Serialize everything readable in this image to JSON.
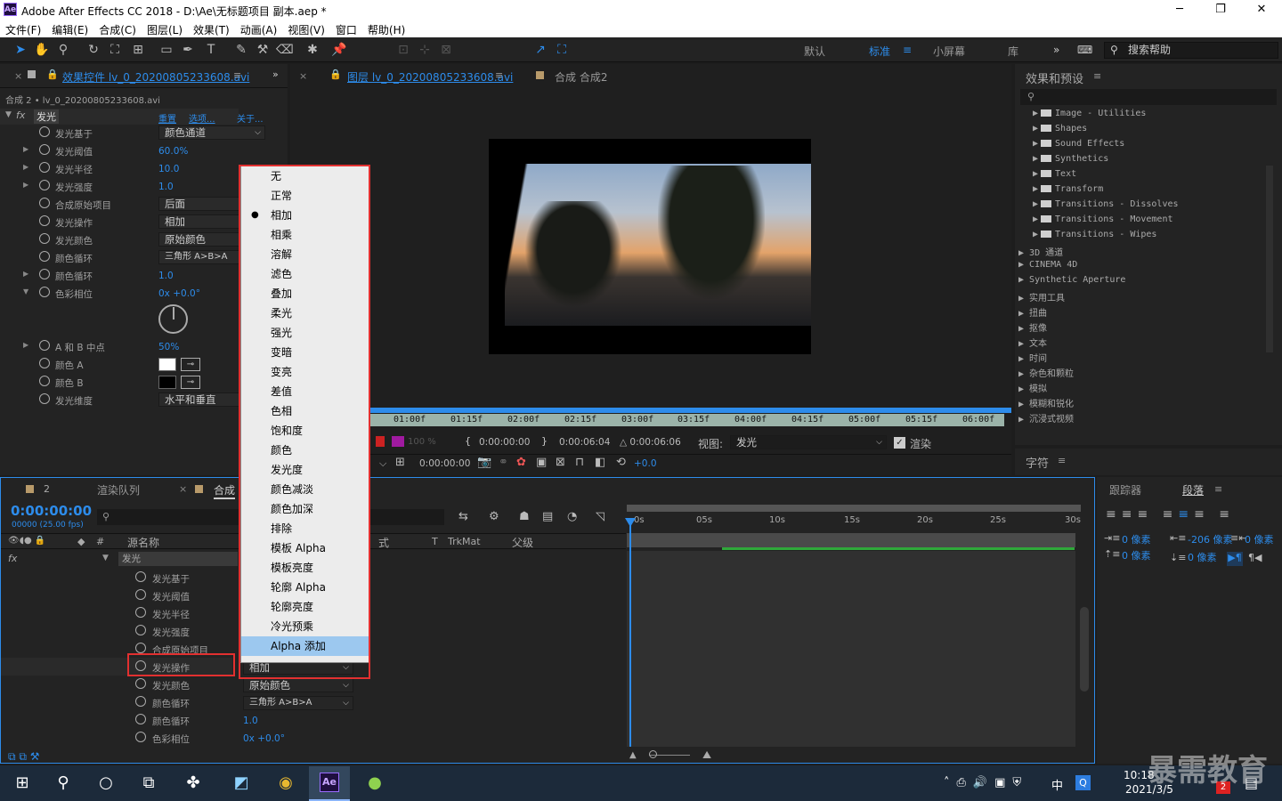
{
  "window": {
    "title": "Adobe After Effects CC 2018 - D:\\Ae\\无标题项目 副本.aep *",
    "logo": "Ae",
    "minimize": "─",
    "maximize": "❐",
    "close": "✕"
  },
  "menubar": [
    "文件(F)",
    "编辑(E)",
    "合成(C)",
    "图层(L)",
    "效果(T)",
    "动画(A)",
    "视图(V)",
    "窗口",
    "帮助(H)"
  ],
  "toolbar": {
    "snap_label": "对齐",
    "workspaces": [
      "默认",
      "标准",
      "小屏幕",
      "库"
    ],
    "help_placeholder": "搜索帮助"
  },
  "effect_controls": {
    "tab_label": "效果控件 lv_0_20200805233608.avi",
    "breadcrumb": "合成 2 • lv_0_20200805233608.avi",
    "effect_name": "发光",
    "reset": "重置",
    "options": "选项...",
    "about": "关于...",
    "properties": [
      {
        "label": "发光基于",
        "value": "颜色通道",
        "kind": "dropdown"
      },
      {
        "label": "发光阈值",
        "value": "60.0%",
        "kind": "value"
      },
      {
        "label": "发光半径",
        "value": "10.0",
        "kind": "value"
      },
      {
        "label": "发光强度",
        "value": "1.0",
        "kind": "value"
      },
      {
        "label": "合成原始项目",
        "value": "后面",
        "kind": "dropdown"
      },
      {
        "label": "发光操作",
        "value": "相加",
        "kind": "dropdown"
      },
      {
        "label": "发光颜色",
        "value": "原始颜色",
        "kind": "dropdown"
      },
      {
        "label": "颜色循环",
        "value": "三角形 A>B>A",
        "kind": "dropdown"
      },
      {
        "label": "颜色循环",
        "value": "1.0",
        "kind": "value"
      },
      {
        "label": "色彩相位",
        "value": "0x +0.0°",
        "kind": "value"
      },
      {
        "label": "A 和 B 中点",
        "value": "50%",
        "kind": "value"
      },
      {
        "label": "颜色 A",
        "value": "",
        "kind": "color"
      },
      {
        "label": "颜色 B",
        "value": "",
        "kind": "color"
      },
      {
        "label": "发光维度",
        "value": "水平和垂直",
        "kind": "dropdown"
      }
    ]
  },
  "blend_menu": {
    "items": [
      "无",
      "正常",
      "相加",
      "相乘",
      "溶解",
      "滤色",
      "叠加",
      "柔光",
      "强光",
      "变暗",
      "变亮",
      "差值",
      "色相",
      "饱和度",
      "颜色",
      "发光度",
      "颜色减淡",
      "颜色加深",
      "排除",
      "模板 Alpha",
      "模板亮度",
      "轮廓 Alpha",
      "轮廓亮度",
      "冷光预乘",
      "Alpha 添加"
    ],
    "checked": "相加",
    "highlighted": "Alpha 添加"
  },
  "viewer": {
    "layer_tab": "图层 lv_0_20200805233608.avi",
    "comp_tab": "合成 合成2",
    "ruler": [
      "01:00f",
      "01:15f",
      "02:00f",
      "02:15f",
      "03:00f",
      "03:15f",
      "04:00f",
      "04:15f",
      "05:00f",
      "05:15f",
      "06:00f"
    ],
    "opacity": "100 %",
    "tc_in": "0:00:00:00",
    "tc_out": "0:00:06:04",
    "tc_dur": "△ 0:00:06:06",
    "view_label": "视图:",
    "view_value": "发光",
    "render_label": "渲染",
    "tc_bottom": "0:00:00:00",
    "exposure": "+0.0"
  },
  "effects_presets": {
    "title": "效果和预设",
    "folders": [
      "Image - Utilities",
      "Shapes",
      "Sound Effects",
      "Synthetics",
      "Text",
      "Transform",
      "Transitions - Dissolves",
      "Transitions - Movement",
      "Transitions - Wipes"
    ],
    "categories": [
      "3D 通道",
      "CINEMA 4D",
      "Synthetic Aperture",
      "实用工具",
      "扭曲",
      "抠像",
      "文本",
      "时间",
      "杂色和颗粒",
      "模拟",
      "模糊和锐化",
      "沉浸式视频"
    ]
  },
  "character_tab": "字符",
  "timeline": {
    "tab_render_queue": "渲染队列",
    "tab_comp": "合成",
    "tab_number": "2",
    "timecode": "0:00:00:00",
    "fps": "00000 (25.00 fps)",
    "col_name": "源名称",
    "col_hash": "#",
    "col_mode": "式",
    "col_t": "T",
    "col_trkmat": "TrkMat",
    "col_parent": "父级",
    "layer_name": "发光",
    "props": [
      "发光基于",
      "发光阈值",
      "发光半径",
      "发光强度",
      "合成原始项目",
      "发光操作",
      "发光颜色",
      "颜色循环",
      "颜色循环",
      "色彩相位"
    ],
    "op_value": "相加",
    "color_value": "原始颜色",
    "cycle_value": "三角形 A>B>A",
    "cycle_num": "1.0",
    "phase_value": "0x +0.0°",
    "ruler": [
      "0s",
      "05s",
      "10s",
      "15s",
      "20s",
      "25s",
      "30s"
    ]
  },
  "paragraph": {
    "tab_tracker": "跟踪器",
    "tab_paragraph": "段落",
    "indent1": "0 像素",
    "indent2": "-206 像素",
    "indent3": "0 像素",
    "space1": "0 像素",
    "space2": "0 像素"
  },
  "taskbar": {
    "time": "10:18",
    "date": "2021/3/5",
    "ime": "中",
    "badge": "2"
  },
  "watermark": "暴需教育"
}
